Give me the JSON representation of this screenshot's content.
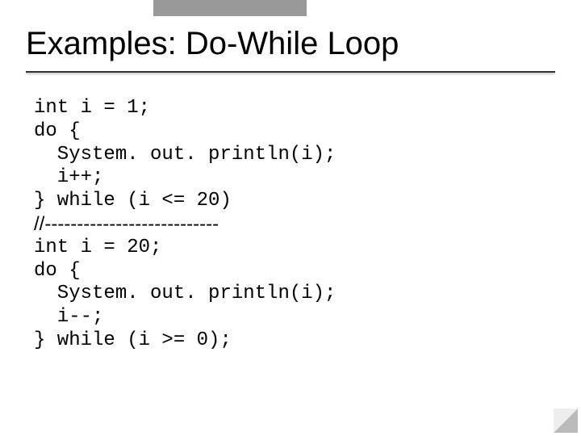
{
  "title": "Examples: Do-While Loop",
  "code_block_1": "int i = 1;\ndo {\n  System. out. println(i);\n  i++;\n} while (i <= 20)",
  "divider": "//---------------------------",
  "code_block_2": "int i = 20;\ndo {\n  System. out. println(i);\n  i--;\n} while (i >= 0);"
}
